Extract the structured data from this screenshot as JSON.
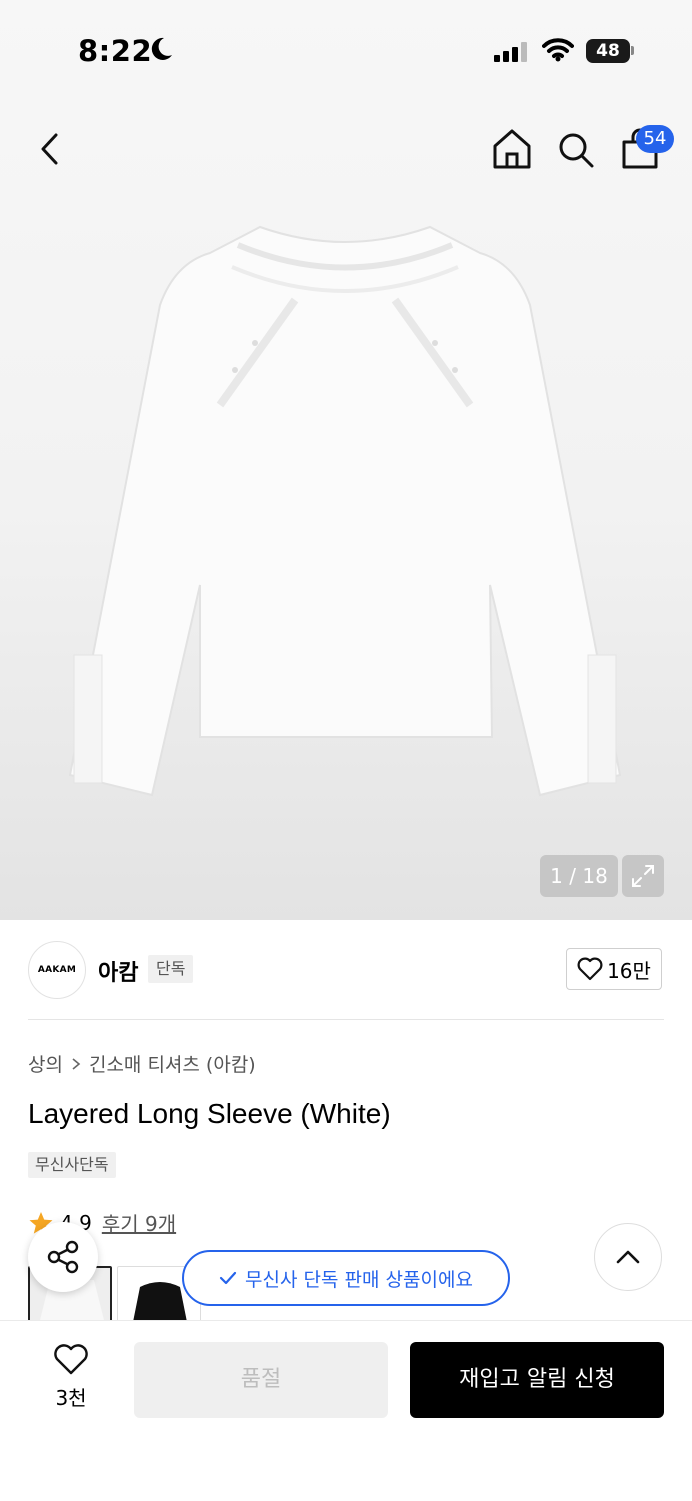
{
  "status_bar": {
    "time": "8:22",
    "battery": "48"
  },
  "header": {
    "cart_count": "54"
  },
  "gallery": {
    "counter": "1 / 18"
  },
  "brand": {
    "logo_text": "AAKAM",
    "name": "아캄",
    "tag": "단독",
    "like_count": "16만"
  },
  "breadcrumb": {
    "category": "상의",
    "subcategory": "긴소매 티셔츠 (아캄)"
  },
  "product": {
    "title": "Layered Long Sleeve (White)",
    "exclusive_tag": "무신사단독",
    "rating": "4.9",
    "review_label": "후기 9개"
  },
  "toast": {
    "message": "무신사 단독 판매 상품이에요"
  },
  "bottom_bar": {
    "wish_count": "3천",
    "soldout_label": "품절",
    "restock_label": "재입고 알림 신청"
  },
  "colors": {
    "accent": "#2563eb",
    "star": "#f5a623"
  }
}
